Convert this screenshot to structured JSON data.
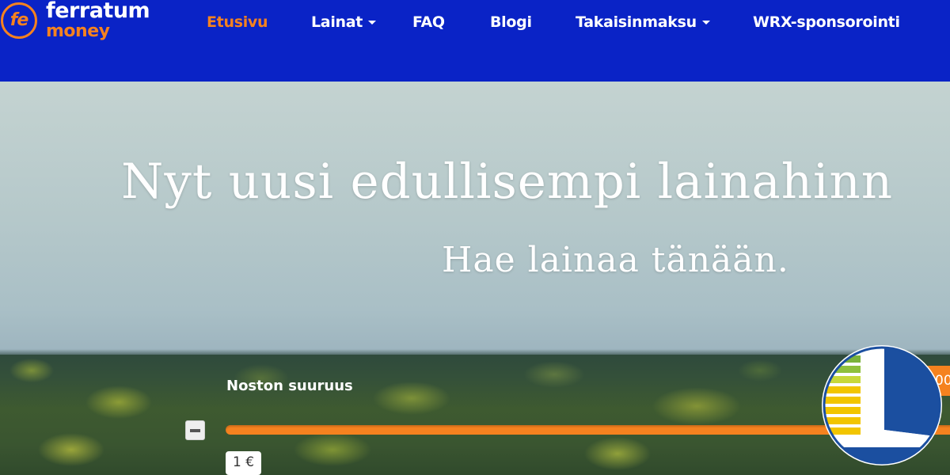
{
  "header": {
    "logo": {
      "mark": "fe",
      "word1": "ferratum",
      "word2": "money",
      "icon": "ferratum-fe-logo"
    },
    "nav": [
      {
        "label": "Etusivu",
        "active": true,
        "dropdown": false
      },
      {
        "label": "Lainat",
        "active": false,
        "dropdown": true
      },
      {
        "label": "FAQ",
        "active": false,
        "dropdown": false
      },
      {
        "label": "Blogi",
        "active": false,
        "dropdown": false
      },
      {
        "label": "Takaisinmaksu",
        "active": false,
        "dropdown": true
      },
      {
        "label": "WRX-sponsorointi",
        "active": false,
        "dropdown": false
      }
    ]
  },
  "hero": {
    "title": "Nyt uusi edullisempi lainahinn",
    "subtitle": "Hae lainaa tänään."
  },
  "loan_widget": {
    "amount_label": "Noston suuruus",
    "minus_icon": "minus-icon",
    "min_value": "1 €",
    "max_value_partial": "00"
  },
  "badge": {
    "icon": "letter-l-badge-icon"
  },
  "colors": {
    "header_bg": "#0a23c6",
    "accent": "#f5821f",
    "badge_blue": "#1b4fa0",
    "badge_yellow": "#f2c500",
    "badge_green": "#7bb23a"
  }
}
